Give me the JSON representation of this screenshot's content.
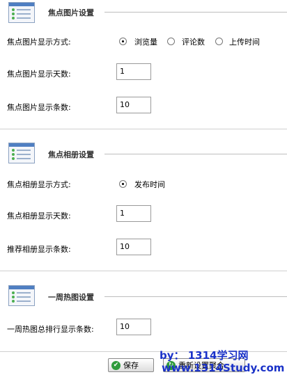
{
  "sections": [
    {
      "title": "焦点图片设置",
      "mode_label": "焦点图片显示方式:",
      "options": [
        "浏览量",
        "评论数",
        "上传时间"
      ],
      "days_label": "焦点图片显示天数:",
      "days_value": "1",
      "count_label": "焦点图片显示条数:",
      "count_value": "10"
    },
    {
      "title": "焦点相册设置",
      "mode_label": "焦点相册显示方式:",
      "options": [
        "发布时间"
      ],
      "days_label": "焦点相册显示天数:",
      "days_value": "1",
      "count_label": "推荐相册显示条数:",
      "count_value": "10"
    },
    {
      "title": "一周热图设置",
      "count_label": "一周热图总排行显示条数:",
      "count_value": "10"
    }
  ],
  "buttons": {
    "save": "保存",
    "reset": "重新设置聚合"
  },
  "watermark": {
    "line1": "by： 1314学习网",
    "line2": "www.1314Study.com"
  },
  "colors": {
    "accent_green": "#2e9a3b",
    "watermark_blue": "#1a32c8"
  }
}
